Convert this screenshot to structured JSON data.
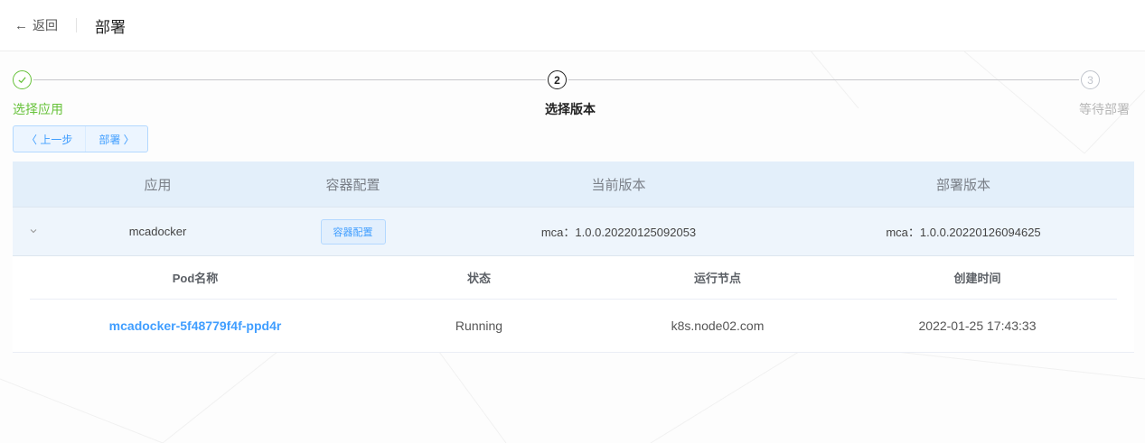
{
  "header": {
    "back_icon": "arrow-left-icon",
    "back_label": "返回",
    "title": "部署"
  },
  "steps": [
    {
      "number": "✓",
      "label": "选择应用",
      "status": "done"
    },
    {
      "number": "2",
      "label": "选择版本",
      "status": "active"
    },
    {
      "number": "3",
      "label": "等待部署",
      "status": "pending"
    }
  ],
  "actions": {
    "prev_label": "〈 上一步",
    "deploy_label": "部署 〉"
  },
  "table": {
    "columns": [
      "应用",
      "容器配置",
      "当前版本",
      "部署版本"
    ],
    "rows": [
      {
        "expand_icon": "chevron-down-icon",
        "app": "mcadocker",
        "config_button": "容器配置",
        "current_version": "mca：1.0.0.20220125092053",
        "deploy_version": "mca：1.0.0.20220126094625"
      }
    ]
  },
  "pods": {
    "columns": [
      "Pod名称",
      "状态",
      "运行节点",
      "创建时间"
    ],
    "rows": [
      {
        "name": "mcadocker-5f48779f4f-ppd4r",
        "status": "Running",
        "node": "k8s.node02.com",
        "created": "2022-01-25 17:43:33"
      }
    ]
  },
  "colors": {
    "success": "#67c23a",
    "primary": "#409eff",
    "header_bg": "#e3effa"
  }
}
